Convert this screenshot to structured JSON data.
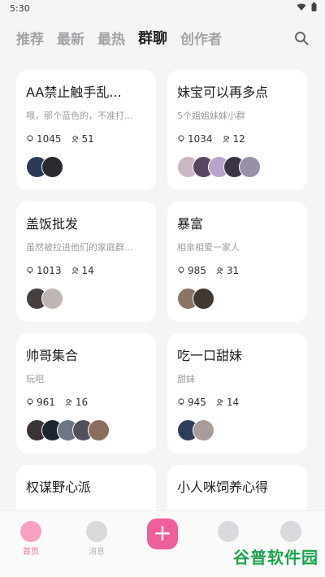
{
  "status": {
    "time": "5:30"
  },
  "tabs": [
    "推荐",
    "最新",
    "最热",
    "群聊",
    "创作者"
  ],
  "active_tab": 3,
  "groups": [
    {
      "name": "AA禁止触手乱...",
      "desc": "喂，那个蓝色的，不准打...",
      "views": "1045",
      "members": "51",
      "avatars": [
        "#2b3a55",
        "#2a2a30"
      ]
    },
    {
      "name": "妹宝可以再多点",
      "desc": "5个姐姐妹妹小群",
      "views": "1034",
      "members": "12",
      "avatars": [
        "#c9b7c6",
        "#5a4660",
        "#b8a3c9",
        "#3c3346",
        "#9a8fa8"
      ]
    },
    {
      "name": "盖饭批发",
      "desc": "虽然被拉进他们的家庭群...",
      "views": "1013",
      "members": "14",
      "avatars": [
        "#45403f",
        "#bfb6b3"
      ]
    },
    {
      "name": "暴富",
      "desc": "相亲相爱一家人",
      "views": "985",
      "members": "31",
      "avatars": [
        "#8a7564",
        "#403833"
      ]
    },
    {
      "name": "帅哥集合",
      "desc": "玩吧",
      "views": "961",
      "members": "16",
      "avatars": [
        "#3a3236",
        "#1f2633",
        "#6d7687",
        "#54505b",
        "#8b6d5d"
      ]
    },
    {
      "name": "吃一口甜妹",
      "desc": "甜妹",
      "views": "945",
      "members": "14",
      "avatars": [
        "#2e3d5b",
        "#a89c9a"
      ]
    },
    {
      "name": "权谋野心派",
      "desc": "",
      "views": "",
      "members": "",
      "avatars": []
    },
    {
      "name": "小人咪饲养心得",
      "desc": "",
      "views": "",
      "members": "",
      "avatars": []
    }
  ],
  "nav": {
    "home_label": "首页",
    "messages_label": "消息"
  },
  "watermark": "谷普软件园",
  "colors": {
    "accent": "#ee5f9c",
    "inactive": "#a3a3a8"
  }
}
